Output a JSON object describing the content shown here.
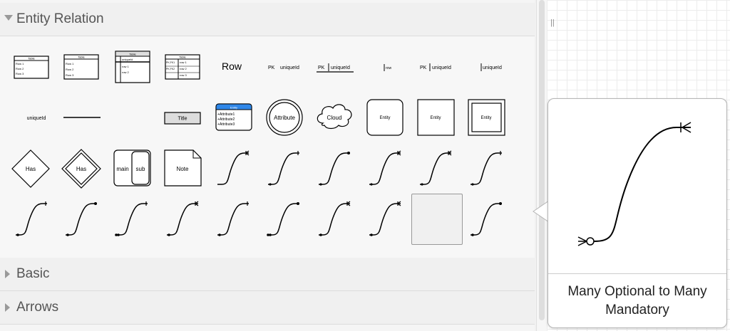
{
  "sections": {
    "entity_relation": {
      "label": "Entity Relation",
      "expanded": true
    },
    "basic": {
      "label": "Basic",
      "expanded": false
    },
    "arrows": {
      "label": "Arrows",
      "expanded": false
    }
  },
  "shapes": {
    "table1_title": "Table",
    "table1_rows": [
      "Row 1",
      "Row 2",
      "Row 3"
    ],
    "table2_title": "Table",
    "table2_rows": [
      "Row 1",
      "Row 2",
      "Row 3"
    ],
    "table3_title": "Table",
    "table3_rows": [
      "uniqueId",
      "row 1",
      "row 2"
    ],
    "table4_title": "Table",
    "table4_keys": [
      "PK,FK1",
      "PK,FK2"
    ],
    "table4_rows": [
      "row 1",
      "row 2",
      "row 3"
    ],
    "row_label": "Row",
    "pk_label": "PK",
    "unique_id": "uniqueId",
    "row_small": "row",
    "title_label": "Title",
    "entity_header": "Entity",
    "attributes": [
      "+Attribute1",
      "+Attribute2",
      "+Attribute3"
    ],
    "attribute_label": "Attribute",
    "cloud_label": "Cloud",
    "entity_label": "Entity",
    "has_label": "Has",
    "main_label": "main",
    "sub_label": "sub",
    "note_label": "Note"
  },
  "tooltip": {
    "title": "Many Optional to Many Mandatory"
  },
  "colors": {
    "entity_header_blue": "#2f87e8",
    "selection_border": "#999999"
  }
}
